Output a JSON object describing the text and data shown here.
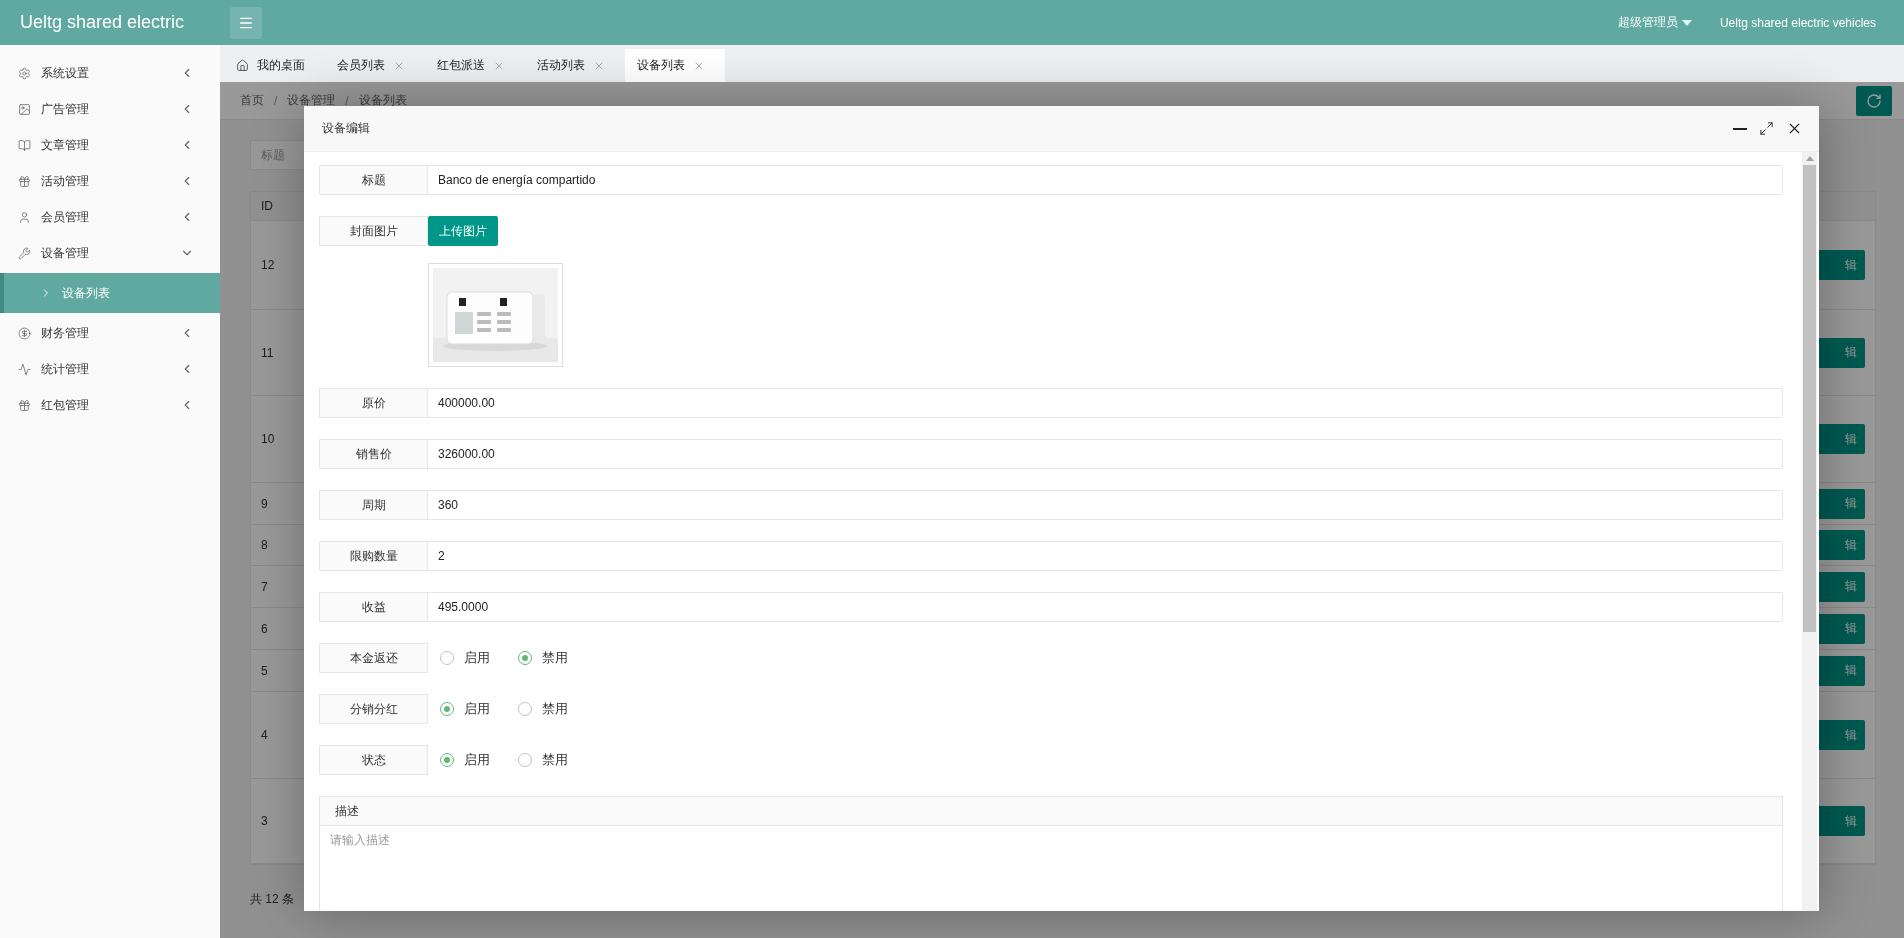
{
  "header": {
    "brand": "Ueltg shared electric",
    "user": "超级管理员",
    "site": "Ueltg shared electric vehicles"
  },
  "sidebar": {
    "items": [
      {
        "label": "系统设置",
        "expanded": false
      },
      {
        "label": "广告管理",
        "expanded": false
      },
      {
        "label": "文章管理",
        "expanded": false
      },
      {
        "label": "活动管理",
        "expanded": false
      },
      {
        "label": "会员管理",
        "expanded": false
      },
      {
        "label": "设备管理",
        "expanded": true,
        "children": [
          {
            "label": "设备列表",
            "selected": true
          }
        ]
      },
      {
        "label": "财务管理",
        "expanded": false
      },
      {
        "label": "统计管理",
        "expanded": false
      },
      {
        "label": "红包管理",
        "expanded": false
      }
    ]
  },
  "tabs": [
    {
      "label": "我的桌面",
      "selected": false,
      "closable": false
    },
    {
      "label": "会员列表",
      "selected": false,
      "closable": true
    },
    {
      "label": "红包派送",
      "selected": false,
      "closable": true
    },
    {
      "label": "活动列表",
      "selected": false,
      "closable": true
    },
    {
      "label": "设备列表",
      "selected": true,
      "closable": true
    }
  ],
  "breadcrumb": {
    "items": [
      "首页",
      "设备管理",
      "设备列表"
    ],
    "separator": "/"
  },
  "page": {
    "search_placeholder": "标题",
    "table": {
      "columns": [
        "ID"
      ],
      "rows": [
        {
          "id": "12",
          "action": "辑"
        },
        {
          "id": "11",
          "action": "辑"
        },
        {
          "id": "10",
          "action": "辑"
        },
        {
          "id": "9",
          "action": "辑"
        },
        {
          "id": "8",
          "action": "辑"
        },
        {
          "id": "7",
          "action": "辑"
        },
        {
          "id": "6",
          "action": "辑"
        },
        {
          "id": "5",
          "action": "辑"
        },
        {
          "id": "4",
          "action": "辑"
        },
        {
          "id": "3",
          "action": "辑"
        }
      ]
    },
    "total": "共 12 条"
  },
  "modal": {
    "title": "设备编辑",
    "fields": [
      {
        "kind": "text",
        "label": "标题",
        "value": "Banco de energía compartido"
      },
      {
        "kind": "upload",
        "label": "封面图片",
        "button": "上传图片"
      },
      {
        "kind": "text",
        "label": "原价",
        "value": "400000.00"
      },
      {
        "kind": "text",
        "label": "销售价",
        "value": "326000.00"
      },
      {
        "kind": "text",
        "label": "周期",
        "value": "360"
      },
      {
        "kind": "text",
        "label": "限购数量",
        "value": "2"
      },
      {
        "kind": "text",
        "label": "收益",
        "value": "495.0000"
      },
      {
        "kind": "radio",
        "label": "本金返还",
        "options": [
          {
            "label": "启用",
            "selected": false
          },
          {
            "label": "禁用",
            "selected": true
          }
        ]
      },
      {
        "kind": "radio",
        "label": "分销分红",
        "options": [
          {
            "label": "启用",
            "selected": true
          },
          {
            "label": "禁用",
            "selected": false
          }
        ]
      },
      {
        "kind": "radio",
        "label": "状态",
        "options": [
          {
            "label": "启用",
            "selected": true
          },
          {
            "label": "禁用",
            "selected": false
          }
        ]
      }
    ],
    "description": {
      "label": "描述",
      "placeholder": "请输入描述"
    }
  }
}
